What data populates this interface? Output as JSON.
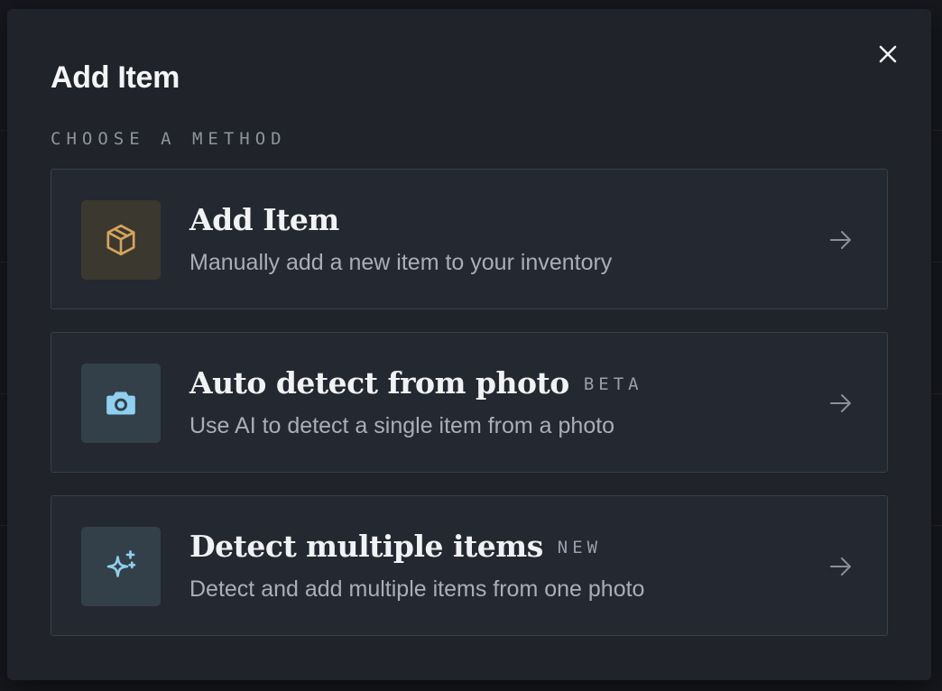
{
  "modal": {
    "title": "Add Item",
    "section_label": "CHOOSE A METHOD",
    "close_icon": "close-icon"
  },
  "options": [
    {
      "title": "Add Item",
      "badge": "",
      "description": "Manually add a new item to your inventory",
      "icon": "package-icon",
      "icon_color": "#d6a55a",
      "tile_color": "#3b3830"
    },
    {
      "title": "Auto detect from photo",
      "badge": "BETA",
      "description": "Use AI to detect a single item from a photo",
      "icon": "camera-icon",
      "icon_color": "#8fd0f0",
      "tile_color": "#344049"
    },
    {
      "title": "Detect multiple items",
      "badge": "NEW",
      "description": "Detect and add multiple items from one photo",
      "icon": "sparkles-icon",
      "icon_color": "#8fd0f0",
      "tile_color": "#344049"
    }
  ],
  "colors": {
    "background": "#16181d",
    "modal": "#20232a",
    "card": "#242831",
    "card_border": "#3a3e47",
    "title_text": "#f4f5f7",
    "muted_text": "#a9aeb7"
  }
}
